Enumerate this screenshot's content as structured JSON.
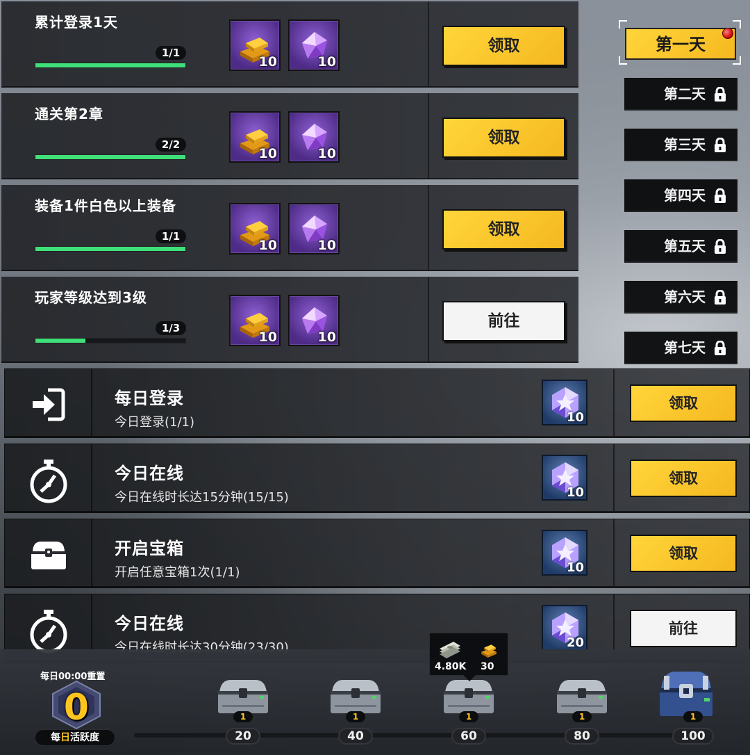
{
  "tasks": [
    {
      "name": "累计登录1天",
      "count": "1/1",
      "progress": 1.0,
      "rewards": [
        "10",
        "10"
      ],
      "button": "领取",
      "button_style": "yellow"
    },
    {
      "name": "通关第2章",
      "count": "2/2",
      "progress": 1.0,
      "rewards": [
        "10",
        "10"
      ],
      "button": "领取",
      "button_style": "yellow"
    },
    {
      "name": "装备1件白色以上装备",
      "count": "1/1",
      "progress": 1.0,
      "rewards": [
        "10",
        "10"
      ],
      "button": "领取",
      "button_style": "yellow"
    },
    {
      "name": "玩家等级达到3级",
      "count": "1/3",
      "progress": 0.333,
      "rewards": [
        "10",
        "10"
      ],
      "button": "前往",
      "button_style": "white"
    }
  ],
  "reward_icons": [
    "gold-bar-icon",
    "purple-gem-icon"
  ],
  "days": [
    {
      "label": "第一天",
      "active": true,
      "locked": false
    },
    {
      "label": "第二天",
      "active": false,
      "locked": true
    },
    {
      "label": "第三天",
      "active": false,
      "locked": true
    },
    {
      "label": "第四天",
      "active": false,
      "locked": true
    },
    {
      "label": "第五天",
      "active": false,
      "locked": true
    },
    {
      "label": "第六天",
      "active": false,
      "locked": true
    },
    {
      "label": "第七天",
      "active": false,
      "locked": true
    }
  ],
  "daily": [
    {
      "icon": "login-icon",
      "title": "每日登录",
      "desc": "今日登录(1/1)",
      "reward": "10",
      "button": "领取",
      "button_style": "yellow"
    },
    {
      "icon": "stopwatch-icon",
      "title": "今日在线",
      "desc": "今日在线时长达15分钟(15/15)",
      "reward": "10",
      "button": "领取",
      "button_style": "yellow"
    },
    {
      "icon": "treasure-chest-icon",
      "title": "开启宝箱",
      "desc": "开启任意宝箱1次(1/1)",
      "reward": "10",
      "button": "领取",
      "button_style": "yellow"
    },
    {
      "icon": "stopwatch-icon",
      "title": "今日在线",
      "desc": "今日在线时长达30分钟(23/30)",
      "reward": "20",
      "button": "前往",
      "button_style": "white"
    }
  ],
  "activity": {
    "reset_text": "每日00:00重置",
    "value": "0",
    "label_pre": "每",
    "label_hl": "日",
    "label_post": "活跃度",
    "milestones": [
      "20",
      "40",
      "60",
      "80",
      "100"
    ],
    "chest_counts": [
      "1",
      "1",
      "1",
      "1",
      "1"
    ],
    "tooltip": {
      "cash": "4.80K",
      "gold": "30"
    }
  },
  "colors": {
    "accent_yellow": "#ffd63a",
    "progress_green": "#3fe07a",
    "active_value": "#ffc51e",
    "notify_red": "#d11010"
  }
}
